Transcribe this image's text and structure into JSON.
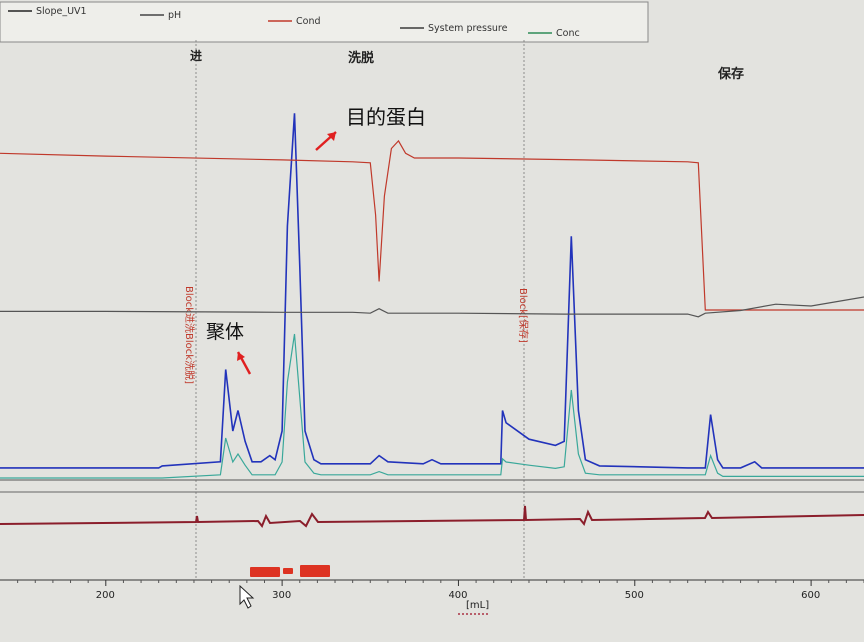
{
  "legend": [
    {
      "label": "Slope_UV1",
      "color": "#222222"
    },
    {
      "label": "pH",
      "color": "#444444"
    },
    {
      "label": "Cond",
      "color": "#c0392b"
    },
    {
      "label": "System pressure",
      "color": "#3a3a3a"
    },
    {
      "label": "Conc",
      "color": "#2e8b57"
    }
  ],
  "phase_labels": {
    "load_fragment": "进",
    "elution": "洗脱",
    "hold": "保存"
  },
  "blocks": [
    {
      "text": "Block进洗Block洗脱]",
      "x": 240
    },
    {
      "text": "Block[保存]",
      "x": 425
    }
  ],
  "annotations": {
    "target_protein": "目的蛋白",
    "aggregate": "聚体"
  },
  "chart_data": {
    "type": "line",
    "xlabel": "[mL]",
    "ylabel": "",
    "title": "",
    "xlim": [
      140,
      630
    ],
    "xticks": [
      200,
      300,
      400,
      500,
      600
    ],
    "grid": false,
    "legend_position": "top",
    "series": [
      {
        "name": "UV",
        "color": "#2233bb",
        "x": [
          140,
          190,
          230,
          232,
          265,
          268,
          272,
          275,
          279,
          283,
          288,
          293,
          296,
          300,
          303,
          307,
          310,
          313,
          318,
          322,
          330,
          350,
          355,
          360,
          380,
          385,
          390,
          400,
          424,
          425,
          427,
          440,
          455,
          460,
          464,
          468,
          472,
          480,
          530,
          540,
          543,
          547,
          550,
          560,
          568,
          572,
          580,
          630
        ],
        "y": [
          2,
          2,
          2,
          3,
          5,
          50,
          20,
          30,
          15,
          5,
          5,
          8,
          6,
          20,
          120,
          175,
          100,
          20,
          6,
          4,
          4,
          4,
          8,
          5,
          4,
          6,
          4,
          4,
          4,
          30,
          24,
          16,
          13,
          15,
          115,
          30,
          6,
          3,
          2,
          2,
          28,
          6,
          2,
          2,
          5,
          2,
          2,
          2
        ]
      },
      {
        "name": "Conc",
        "color": "#3aa89a",
        "x": [
          140,
          230,
          232,
          265,
          268,
          272,
          275,
          279,
          283,
          296,
          300,
          303,
          307,
          310,
          313,
          318,
          322,
          350,
          355,
          360,
          424,
          425,
          427,
          440,
          455,
          460,
          464,
          468,
          472,
          480,
          540,
          543,
          547,
          550,
          630
        ],
        "y": [
          0,
          0,
          0,
          2,
          25,
          10,
          15,
          8,
          2,
          2,
          10,
          60,
          90,
          50,
          10,
          3,
          2,
          2,
          4,
          2,
          2,
          12,
          10,
          8,
          6,
          7,
          55,
          15,
          3,
          2,
          2,
          14,
          3,
          1,
          1
        ]
      },
      {
        "name": "Cond",
        "color": "#c0392b",
        "x": [
          140,
          200,
          300,
          340,
          350,
          353,
          355,
          358,
          362,
          366,
          370,
          375,
          400,
          470,
          530,
          536,
          540,
          560,
          630
        ],
        "y": [
          165,
          162,
          158,
          156,
          155,
          100,
          30,
          120,
          170,
          178,
          165,
          160,
          160,
          158,
          156,
          155,
          0,
          0,
          0
        ]
      },
      {
        "name": "pH",
        "color": "#555555",
        "x": [
          140,
          200,
          300,
          340,
          350,
          355,
          360,
          400,
          460,
          530,
          536,
          540,
          560,
          580,
          600,
          630
        ],
        "y": [
          54,
          54,
          53,
          53,
          52,
          57,
          52,
          52,
          51,
          51,
          48,
          52,
          55,
          62,
          60,
          70
        ]
      }
    ]
  }
}
